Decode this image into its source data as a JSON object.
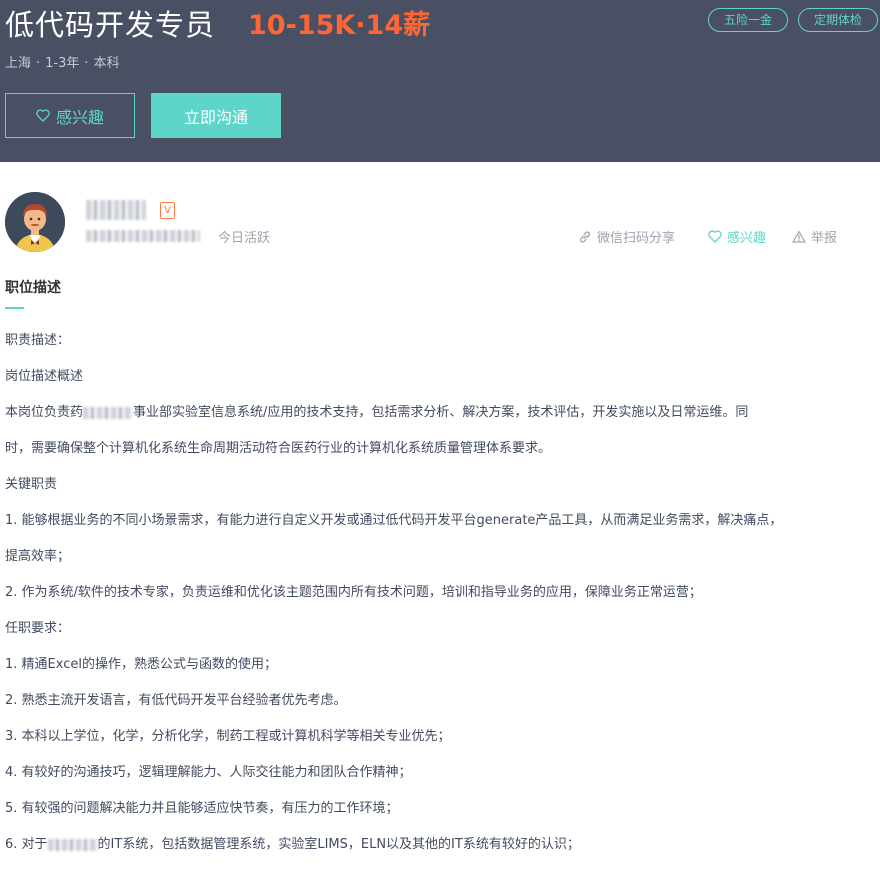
{
  "job": {
    "title": "低代码开发专员",
    "salary": "10-15K·14薪",
    "tags": [
      "五险一金",
      "定期体检"
    ],
    "location": "上海",
    "experience": "1-3年",
    "degree": "本科",
    "interest_label": "感兴趣",
    "chat_label": "立即沟通"
  },
  "recruiter": {
    "badge": "V",
    "status": "今日活跃",
    "actions": {
      "share": "微信扫码分享",
      "interest": "感兴趣",
      "report": "举报"
    }
  },
  "description": {
    "section_title": "职位描述",
    "lines": [
      "职责描述：",
      "岗位描述概述",
      {
        "before": "本岗位负责药",
        "after": "事业部实验室信息系统/应用的技术支持，包括需求分析、解决方案，技术评估，开发实施以及日常运维。同"
      },
      "时，需要确保整个计算机化系统生命周期活动符合医药行业的计算机化系统质量管理体系要求。",
      "关键职责",
      "1. 能够根据业务的不同小场景需求，有能力进行自定义开发或通过低代码开发平台generate产品工具，从而满足业务需求，解决痛点，",
      "提高效率；",
      "2. 作为系统/软件的技术专家，负责运维和优化该主题范围内所有技术问题，培训和指导业务的应用，保障业务正常运营；",
      "任职要求：",
      "1. 精通Excel的操作，熟悉公式与函数的使用；",
      "2. 熟悉主流开发语言，有低代码开发平台经验者优先考虑。",
      "3. 本科以上学位，化学，分析化学，制药工程或计算机科学等相关专业优先；",
      "4. 有较好的沟通技巧，逻辑理解能力、人际交往能力和团队合作精神；",
      "5. 有较强的问题解决能力并且能够适应快节奏，有压力的工作环境；",
      {
        "before": "6. 对于",
        "after": "的IT系统，包括数据管理系统，实验室LIMS，ELN以及其他的IT系统有较好的认识；"
      }
    ]
  },
  "colors": {
    "banner": "#4a5064",
    "accent": "#5dd5c8",
    "salary": "#ff6633"
  },
  "icons": [
    "heart-icon",
    "link-icon",
    "warning-icon"
  ]
}
